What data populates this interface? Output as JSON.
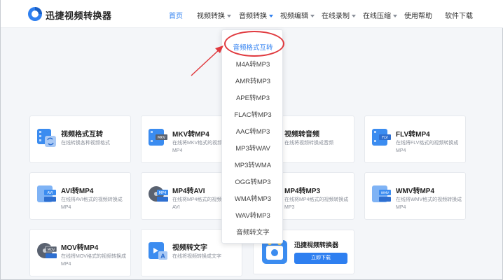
{
  "header": {
    "brand": "迅捷视频转换器",
    "nav": [
      {
        "label": "首页",
        "active": true,
        "dropdown": false
      },
      {
        "label": "视频转换",
        "active": false,
        "dropdown": true
      },
      {
        "label": "音频转换",
        "active": false,
        "dropdown": true,
        "open": true
      },
      {
        "label": "视频编辑",
        "active": false,
        "dropdown": true
      },
      {
        "label": "在线录制",
        "active": false,
        "dropdown": true
      },
      {
        "label": "在线压缩",
        "active": false,
        "dropdown": true
      },
      {
        "label": "使用帮助",
        "active": false,
        "dropdown": false
      },
      {
        "label": "软件下载",
        "active": false,
        "dropdown": false
      }
    ]
  },
  "dropdown": {
    "items": [
      "音频格式互转",
      "M4A转MP3",
      "AMR转MP3",
      "APE转MP3",
      "FLAC转MP3",
      "AAC转MP3",
      "MP3转WAV",
      "MP3转WMA",
      "OGG转MP3",
      "WMA转MP3",
      "WAV转MP3",
      "音频转文字"
    ]
  },
  "cards": [
    {
      "title": "视频格式互转",
      "desc": "在线转换各种视频格式",
      "icon_label": "",
      "icon": "video-convert-icon"
    },
    {
      "title": "MKV转MP4",
      "desc": "在线将MKV格式的视频转换成MP4",
      "icon_label": "MKV",
      "icon": "mkv-icon"
    },
    {
      "title": "视频转音频",
      "desc": "在线将视频转换成音频",
      "icon_label": "",
      "icon": "video-to-audio-icon"
    },
    {
      "title": "FLV转MP4",
      "desc": "在线将FLV格式的视频转换成MP4",
      "icon_label": "FLV",
      "icon": "flv-icon"
    },
    {
      "title": "AVI转MP4",
      "desc": "在线将AVI格式的视频转换成MP4",
      "icon_label": "AVI",
      "icon": "avi-icon"
    },
    {
      "title": "MP4转AVI",
      "desc": "在线将MP4格式的视频转换成AVI",
      "icon_label": "MP4",
      "icon": "mp4-icon"
    },
    {
      "title": "MP4转MP3",
      "desc": "在线将MP4格式的视频转换成MP3",
      "icon_label": "",
      "icon": "mp4-to-mp3-icon"
    },
    {
      "title": "WMV转MP4",
      "desc": "在线将WMV格式的视频转换成MP4",
      "icon_label": "WMV",
      "icon": "wmv-icon"
    },
    {
      "title": "MOV转MP4",
      "desc": "在线将MOV格式的视频转换成MP4",
      "icon_label": "MOV",
      "icon": "mov-icon"
    },
    {
      "title": "视频转文字",
      "desc": "在线将视频转换成文字",
      "icon_label": "",
      "icon": "video-to-text-icon"
    }
  ],
  "promo": {
    "title": "迅捷视频转换器",
    "button": "立即下载"
  },
  "colors": {
    "accent": "#2e7ff0",
    "annotation": "#e0393e"
  }
}
